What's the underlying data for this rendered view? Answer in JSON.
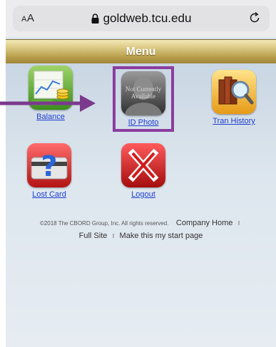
{
  "browser": {
    "text_size_label": "AA",
    "url": "goldweb.tcu.edu"
  },
  "header": {
    "title": "Menu"
  },
  "tiles": [
    {
      "label": "Balance",
      "icon": "balance-chart-icon"
    },
    {
      "label": "ID Photo",
      "icon": "id-photo-placeholder-icon",
      "icon_text": "Not Currently Available"
    },
    {
      "label": "Tran History",
      "icon": "tran-history-icon"
    },
    {
      "label": "Lost Card",
      "icon": "lost-card-icon"
    },
    {
      "label": "Logout",
      "icon": "logout-x-icon"
    }
  ],
  "footer": {
    "copyright": "©2018 The CBORD Group, Inc. All rights reserved.",
    "company_home": "Company Home",
    "separator": "I",
    "full_site": "Full Site",
    "start_page": "Make this my start page"
  },
  "colors": {
    "header_gold": "#b89f4c",
    "link_blue": "#1f3fcf",
    "highlight_purple": "#8a3d9e"
  }
}
